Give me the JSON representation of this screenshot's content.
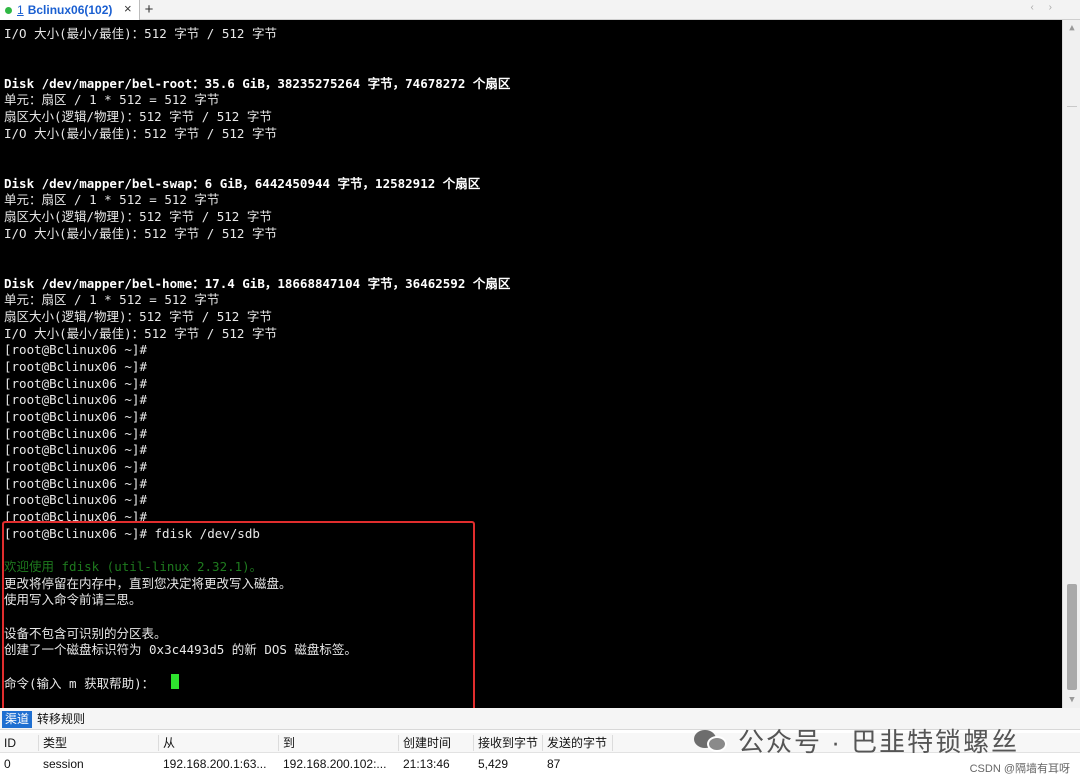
{
  "tabbar": {
    "tab_number": "1",
    "tab_title": "Bclinux06(102)",
    "close_glyph": "×",
    "add_glyph": "+",
    "nav_arrows": "‹ ›"
  },
  "terminal": {
    "lines": [
      "I/O 大小(最小/最佳)：512 字节 / 512 字节",
      "Disk /dev/mapper/bel-root：35.6 GiB，38235275264 字节，74678272 个扇区",
      "单元：扇区 / 1 * 512 = 512 字节",
      "扇区大小(逻辑/物理)：512 字节 / 512 字节",
      "I/O 大小(最小/最佳)：512 字节 / 512 字节",
      "Disk /dev/mapper/bel-swap：6 GiB，6442450944 字节，12582912 个扇区",
      "单元：扇区 / 1 * 512 = 512 字节",
      "扇区大小(逻辑/物理)：512 字节 / 512 字节",
      "I/O 大小(最小/最佳)：512 字节 / 512 字节",
      "Disk /dev/mapper/bel-home：17.4 GiB，18668847104 字节，36462592 个扇区",
      "单元：扇区 / 1 * 512 = 512 字节",
      "扇区大小(逻辑/物理)：512 字节 / 512 字节",
      "I/O 大小(最小/最佳)：512 字节 / 512 字节",
      "[root@Bclinux06 ~]#",
      "[root@Bclinux06 ~]#",
      "[root@Bclinux06 ~]#",
      "[root@Bclinux06 ~]#",
      "[root@Bclinux06 ~]#",
      "[root@Bclinux06 ~]#",
      "[root@Bclinux06 ~]#",
      "[root@Bclinux06 ~]#",
      "[root@Bclinux06 ~]#",
      "[root@Bclinux06 ~]#",
      "[root@Bclinux06 ~]#",
      "[root@Bclinux06 ~]# fdisk /dev/sdb",
      "欢迎使用 fdisk (util-linux 2.32.1)。",
      "更改将停留在内存中，直到您决定将更改写入磁盘。",
      "使用写入命令前请三思。",
      "设备不包含可识别的分区表。",
      "创建了一个磁盘标识符为 0x3c4493d5 的新 DOS 磁盘标签。",
      "命令(输入 m 获取帮助)："
    ],
    "cursor_color": "#2ee32e",
    "highlight_color": "#e12d2d"
  },
  "scrollbar": {
    "up_glyph": "▲",
    "down_glyph": "▼"
  },
  "bottom": {
    "tabs": [
      "渠道",
      "转移规则"
    ],
    "columns": [
      "ID",
      "类型",
      "从",
      "到",
      "创建时间",
      "接收到字节",
      "发送的字节"
    ],
    "rows": [
      [
        "0",
        "session",
        "192.168.200.1:63...",
        "192.168.200.102:...",
        "21:13:46",
        "5,429",
        "87"
      ]
    ]
  },
  "watermark": {
    "text": "公众号 · 巴韭特锁螺丝",
    "credit": "CSDN @隔墙有耳呀"
  }
}
